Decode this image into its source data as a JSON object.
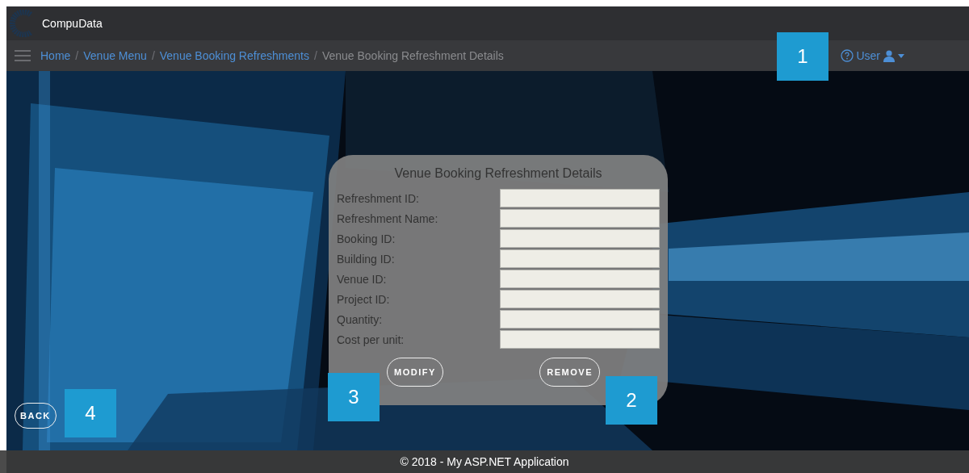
{
  "brand": {
    "name": "CompuData"
  },
  "breadcrumb": [
    {
      "label": "Home",
      "link": true
    },
    {
      "separator": "/",
      "label": "Venue Menu",
      "link": true
    },
    {
      "separator": "/",
      "label": "Venue Booking Refreshments",
      "link": true
    },
    {
      "separator": "/",
      "label": "Venue Booking Refreshment Details",
      "link": false
    }
  ],
  "user_menu": {
    "label": "User"
  },
  "form": {
    "title": "Venue Booking Refreshment Details",
    "fields": [
      {
        "label": "Refreshment ID:"
      },
      {
        "label": "Refreshment Name:"
      },
      {
        "label": "Booking ID:"
      },
      {
        "label": "Building ID:"
      },
      {
        "label": "Venue ID:"
      },
      {
        "label": "Project ID:"
      },
      {
        "label": "Quantity:"
      },
      {
        "label": "Cost per unit:"
      }
    ],
    "buttons": [
      "MODIFY",
      "REMOVE"
    ]
  },
  "back_button": "BACK",
  "callouts": [
    "1",
    "2",
    "3",
    "4"
  ],
  "footer": "© 2018 - My ASP.NET Application"
}
